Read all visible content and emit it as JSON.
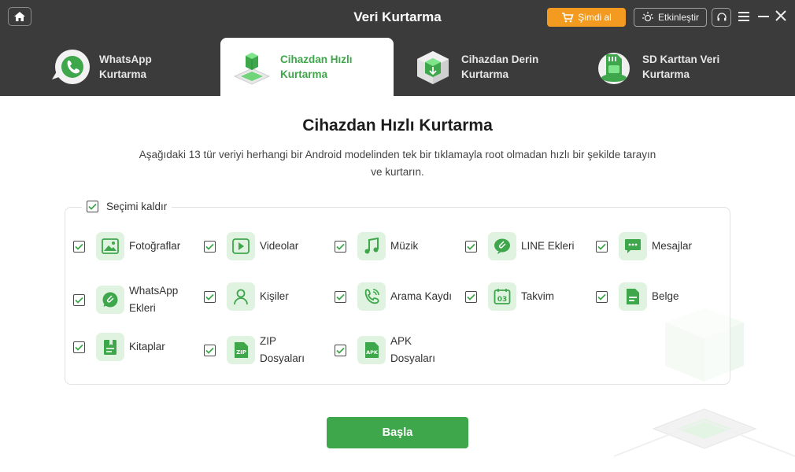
{
  "header": {
    "title": "Veri Kurtarma",
    "buy_label": "Şimdi al",
    "activate_label": "Etkinleştir"
  },
  "tabs": [
    {
      "label_line1": "WhatsApp",
      "label_line2": "Kurtarma",
      "active": false
    },
    {
      "label_line1": "Cihazdan Hızlı",
      "label_line2": "Kurtarma",
      "active": true
    },
    {
      "label_line1": "Cihazdan Derin",
      "label_line2": "Kurtarma",
      "active": false
    },
    {
      "label_line1": "SD Karttan Veri",
      "label_line2": "Kurtarma",
      "active": false
    }
  ],
  "main": {
    "title": "Cihazdan Hızlı Kurtarma",
    "description": "Aşağıdaki 13 tür veriyi herhangi bir Android modelinden tek bir tıklamayla root olmadan hızlı bir şekilde tarayın ve kurtarın.",
    "select_all_label": "Seçimi kaldır",
    "start_label": "Başla"
  },
  "items": [
    {
      "label": "Fotoğraflar",
      "icon": "photo-icon",
      "checked": true
    },
    {
      "label": "Videolar",
      "icon": "video-icon",
      "checked": true
    },
    {
      "label": "Müzik",
      "icon": "music-icon",
      "checked": true
    },
    {
      "label": "LINE Ekleri",
      "icon": "attachment-icon",
      "checked": true
    },
    {
      "label": "Mesajlar",
      "icon": "message-icon",
      "checked": true
    },
    {
      "label": "WhatsApp Ekleri",
      "icon": "whatsapp-attachment-icon",
      "checked": true
    },
    {
      "label": "Kişiler",
      "icon": "contact-icon",
      "checked": true
    },
    {
      "label": "Arama Kaydı",
      "icon": "call-log-icon",
      "checked": true
    },
    {
      "label": "Takvim",
      "icon": "calendar-icon",
      "checked": true
    },
    {
      "label": "Belge",
      "icon": "document-icon",
      "checked": true
    },
    {
      "label": "Kitaplar",
      "icon": "book-icon",
      "checked": true
    },
    {
      "label": "ZIP Dosyaları",
      "icon": "zip-icon",
      "checked": true
    },
    {
      "label": "APK Dosyaları",
      "icon": "apk-icon",
      "checked": true
    }
  ],
  "colors": {
    "accent": "#3ea64b",
    "header_bg": "#3b3b3b",
    "buy_button": "#f39a21"
  }
}
